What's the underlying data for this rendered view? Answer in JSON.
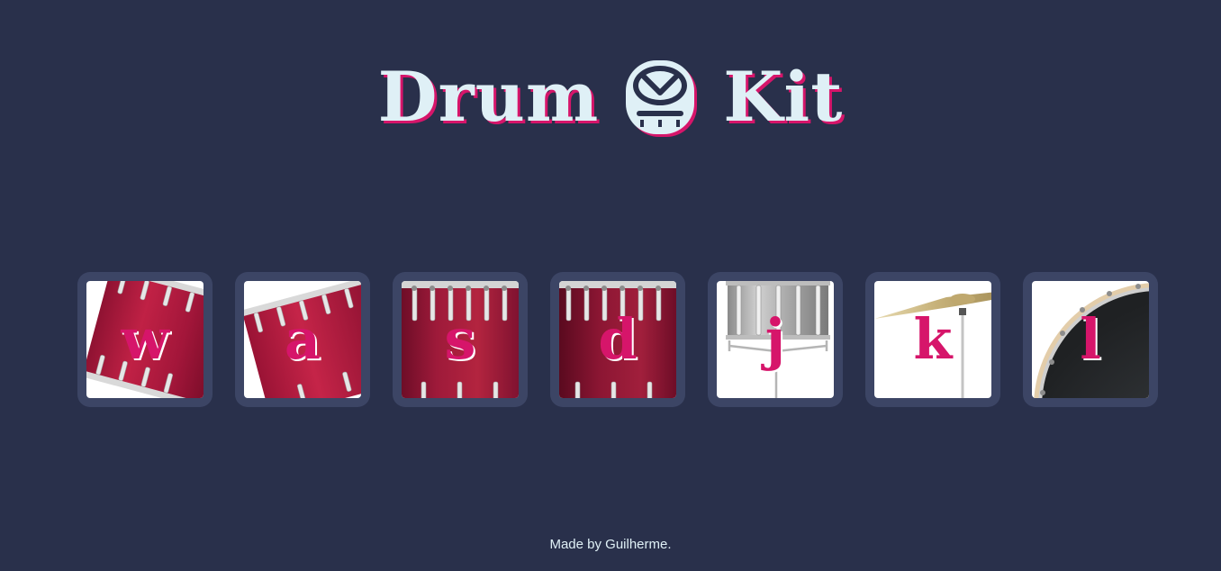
{
  "header": {
    "title_left": "Drum",
    "title_right": "Kit",
    "logo_icon": "drum-icon"
  },
  "keys": [
    {
      "letter": "w",
      "icon": "tom-drum-icon"
    },
    {
      "letter": "a",
      "icon": "tom-drum-icon"
    },
    {
      "letter": "s",
      "icon": "snare-drum-icon"
    },
    {
      "letter": "d",
      "icon": "floor-tom-icon"
    },
    {
      "letter": "j",
      "icon": "snare-stand-icon"
    },
    {
      "letter": "k",
      "icon": "crash-cymbal-icon"
    },
    {
      "letter": "l",
      "icon": "kick-drum-icon"
    }
  ],
  "footer": {
    "text": "Made by Guilherme."
  },
  "colors": {
    "background": "#29304b",
    "key_frame": "#3c4565",
    "accent": "#d6156a",
    "title_text": "#dff0f6"
  }
}
